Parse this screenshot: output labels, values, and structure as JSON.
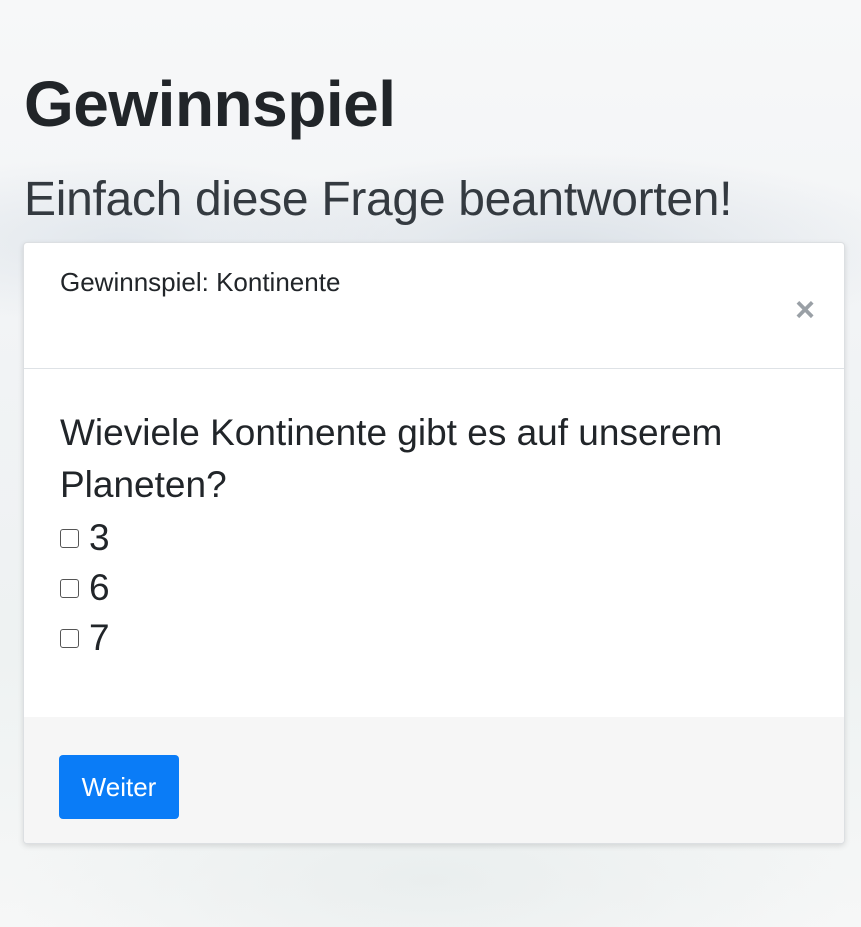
{
  "page": {
    "title": "Gewinnspiel",
    "subtitle": "Einfach diese Frage beantworten!"
  },
  "modal": {
    "title": "Gewinnspiel: Kontinente",
    "close_icon": "×",
    "question": "Wieviele Kontinente gibt es auf unserem Planeten?",
    "options": [
      {
        "label": "3",
        "checked": false
      },
      {
        "label": "6",
        "checked": false
      },
      {
        "label": "7",
        "checked": false
      }
    ],
    "submit_label": "Weiter"
  },
  "colors": {
    "primary_button": "#0a7cf7",
    "footer_background": "#f6f6f6",
    "close_icon": "#9aa0a6"
  }
}
